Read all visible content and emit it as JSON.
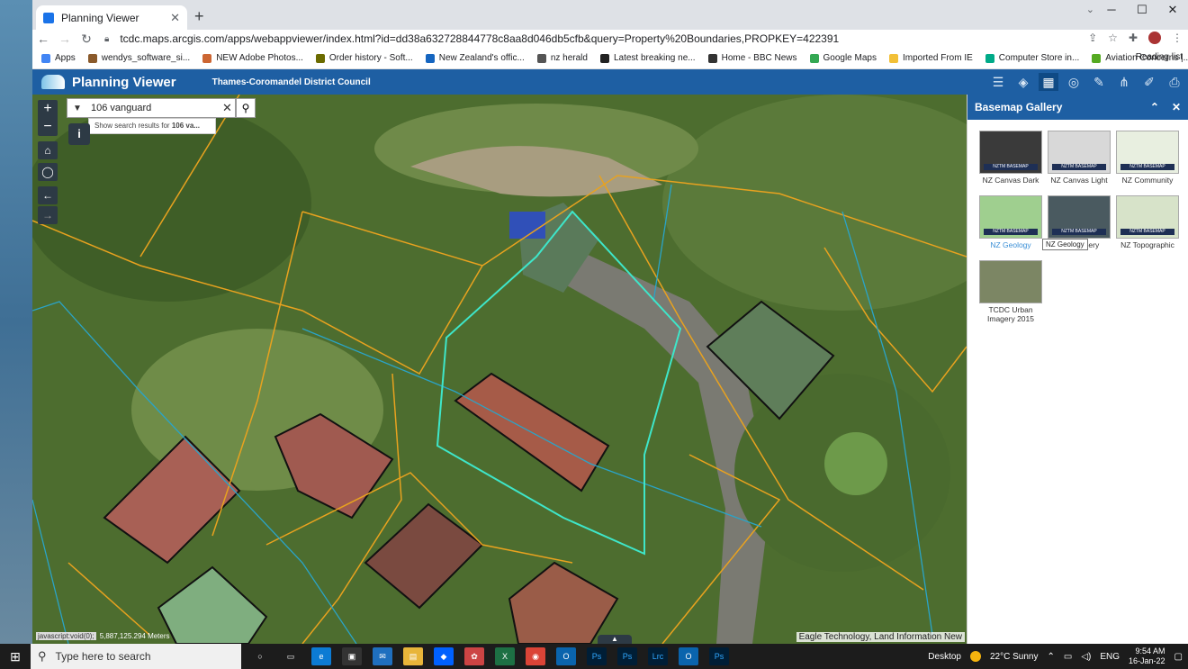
{
  "browser": {
    "tab_title": "Planning Viewer",
    "url": "tcdc.maps.arcgis.com/apps/webappviewer/index.html?id=dd38a632728844778c8aa8d046db5cfb&query=Property%20Boundaries,PROPKEY=422391",
    "bookmarks": [
      "Apps",
      "wendys_software_si...",
      "NEW Adobe Photos...",
      "Order history - Soft...",
      "New Zealand's offic...",
      "nz herald",
      "Latest breaking ne...",
      "Home - BBC News",
      "Google Maps",
      "Imported From IE",
      "Computer Store in...",
      "Aviation Concerns |..."
    ],
    "reading_list": "Reading list"
  },
  "app": {
    "title": "Planning Viewer",
    "subtitle": "Thames-Coromandel District Council"
  },
  "search": {
    "value": "106 vanguard",
    "suggestion_prefix": "Show search results for ",
    "suggestion_bold": "106 va..."
  },
  "map": {
    "attribution": "Eagle Technology, Land Information New",
    "status": "javascript:void(0);",
    "scale": "5,887,125.294 Meters"
  },
  "gallery": {
    "title": "Basemap Gallery",
    "thumb_label": "NZTM BASEMAP",
    "items": [
      {
        "label": "NZ Canvas Dark",
        "color": "#3a3a3a"
      },
      {
        "label": "NZ Canvas Light",
        "color": "#d8d8d8"
      },
      {
        "label": "NZ Community",
        "color": "#e8efe0"
      },
      {
        "label": "NZ Geology",
        "color": "#9fcf8f"
      },
      {
        "label": "NZ Imagery",
        "color": "#4a5a60"
      },
      {
        "label": "NZ Topographic",
        "color": "#d7e3c9"
      },
      {
        "label": "TCDC Urban Imagery 2015",
        "color": "#7c8664"
      }
    ],
    "tooltip": "NZ Geology"
  },
  "taskbar": {
    "search_placeholder": "Type here to search",
    "desktop": "Desktop",
    "weather": "22°C  Sunny",
    "lang": "ENG",
    "time": "9:54 AM",
    "date": "16-Jan-22"
  }
}
